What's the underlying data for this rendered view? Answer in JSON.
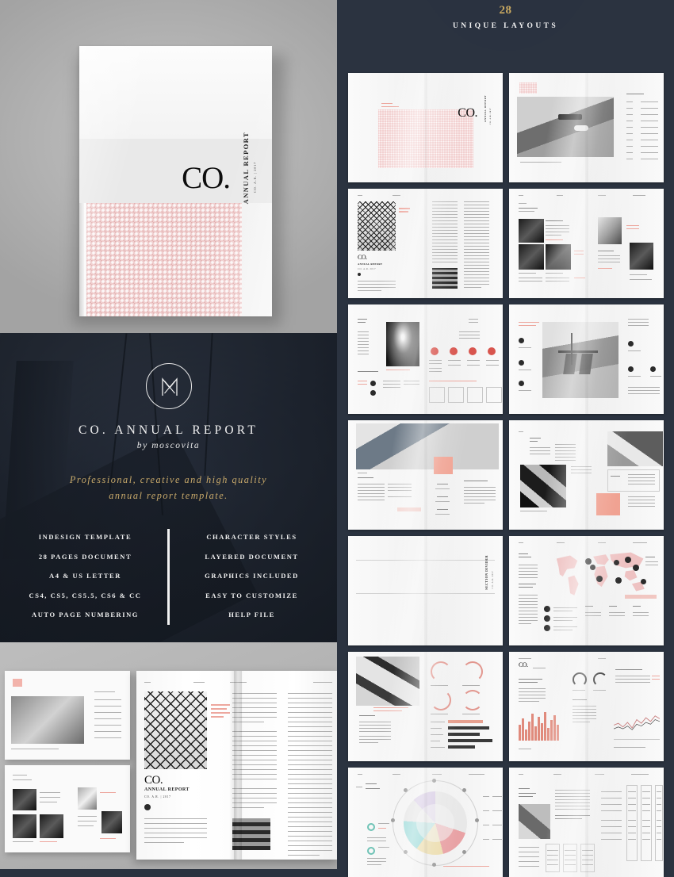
{
  "cover": {
    "brand": "CO.",
    "vertical_title": "ANNUAL REPORT",
    "vertical_sub": "CO. A.R. | 2017"
  },
  "hero": {
    "logo_icon": "monogram-m-circle-icon",
    "title": "CO. ANNUAL REPORT",
    "byline": "by moscovita",
    "tagline_line1": "Professional, creative and high quality",
    "tagline_line2": "annual report template.",
    "features_left": [
      "INDESIGN TEMPLATE",
      "28 PAGES DOCUMENT",
      "A4 & US LETTER",
      "CS4, CS5, CS5.5, CS6 & CC",
      "AUTO PAGE NUMBERING"
    ],
    "features_right": [
      "CHARACTER STYLES",
      "LAYERED DOCUMENT",
      "GRAPHICS INCLUDED",
      "EASY TO CUSTOMIZE",
      "HELP FILE"
    ]
  },
  "header": {
    "count": "28",
    "label": "UNIQUE LAYOUTS"
  },
  "mockup": {
    "brand": "CO.",
    "subtitle": "ANNUAL REPORT",
    "year": "CO. A.R. | 2017"
  },
  "spreads": [
    {
      "id": 1,
      "name": "cover-spread",
      "caption": "CO. cover with pink geometric pattern"
    },
    {
      "id": 2,
      "name": "contents-spread",
      "caption": "Desk photo with table of contents"
    },
    {
      "id": 3,
      "name": "intro-spread",
      "caption": "CO. annual report intro with architecture photo"
    },
    {
      "id": 4,
      "name": "team-spread",
      "caption": "Team portraits grid"
    },
    {
      "id": 5,
      "name": "profile-spread",
      "caption": "Portrait profile with icon stats"
    },
    {
      "id": 6,
      "name": "interior-spread",
      "caption": "Office interior photo with bullet points"
    },
    {
      "id": 7,
      "name": "statistics-spread",
      "caption": "Photo with percentage statistics"
    },
    {
      "id": 8,
      "name": "report-spread",
      "caption": "Architecture photos with highlight box"
    },
    {
      "id": 9,
      "name": "divider-spread",
      "caption": "Blank section divider"
    },
    {
      "id": 10,
      "name": "worldmap-spread",
      "caption": "World map with location markers"
    },
    {
      "id": 11,
      "name": "charts-spread",
      "caption": "Donut gauges and horizontal bars"
    },
    {
      "id": 12,
      "name": "analytics-spread",
      "caption": "Bar chart and line graph analytics"
    },
    {
      "id": 13,
      "name": "piechart-spread",
      "caption": "Segmented pie chart diagram"
    },
    {
      "id": 14,
      "name": "financials-spread",
      "caption": "Financial data tables"
    }
  ]
}
